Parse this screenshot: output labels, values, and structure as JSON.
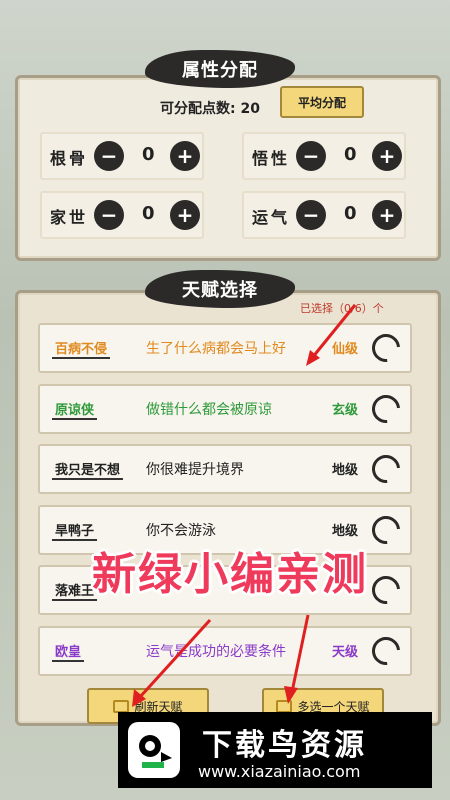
{
  "attributes": {
    "title": "属性分配",
    "points_label": "可分配点数: 20",
    "average_button": "平均分配",
    "items": [
      {
        "name": "根骨",
        "value": "0",
        "minus": "−",
        "plus": "+"
      },
      {
        "name": "悟性",
        "value": "0",
        "minus": "−",
        "plus": "+"
      },
      {
        "name": "家世",
        "value": "0",
        "minus": "−",
        "plus": "+"
      },
      {
        "name": "运气",
        "value": "0",
        "minus": "−",
        "plus": "+"
      }
    ]
  },
  "talents": {
    "title": "天赋选择",
    "selected_count": "已选择（0/6）个",
    "items": [
      {
        "name": "百病不侵",
        "desc": "生了什么病都会马上好",
        "grade": "仙级",
        "color": "#e08a1e"
      },
      {
        "name": "原谅侠",
        "desc": "做错什么都会被原谅",
        "grade": "玄级",
        "color": "#2e9a3a"
      },
      {
        "name": "我只是不想",
        "desc": "你很难提升境界",
        "grade": "地级",
        "color": "#222222"
      },
      {
        "name": "旱鸭子",
        "desc": "你不会游泳",
        "grade": "地级",
        "color": "#222222"
      },
      {
        "name": "落难王",
        "desc": "",
        "grade": "",
        "color": "#222222"
      },
      {
        "name": "欧皇",
        "desc": "运气是成功的必要条件",
        "grade": "天级",
        "color": "#8a3ac9"
      }
    ]
  },
  "buttons": {
    "refresh": "刷新天赋",
    "extra": "多选一个天赋"
  },
  "overlay": {
    "watermark": "新绿小编亲测",
    "logo_text": "下载鸟资源",
    "logo_url": "www.xiazainiao.com",
    "watermark_color": "#ef3a5b"
  }
}
